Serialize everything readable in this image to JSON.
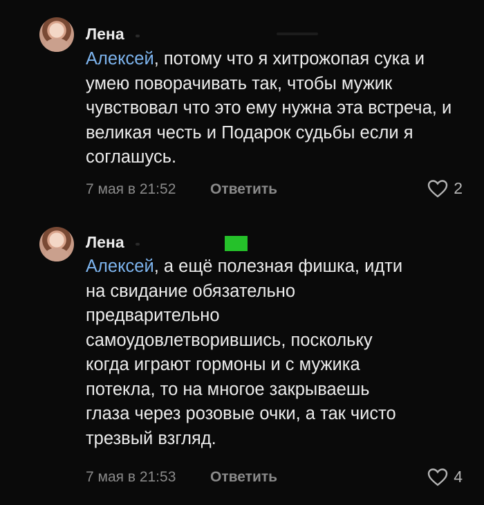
{
  "comments": [
    {
      "author": "Лена",
      "reply_to": "Алексей",
      "text": ", потому что я хитрожопая сука и умею поворачивать так, чтобы мужик чувствовал что это ему нужна эта встреча, и великая честь и Подарок судьбы если я соглашусь.",
      "date": "7 мая в 21:52",
      "reply_label": "Ответить",
      "likes": "2"
    },
    {
      "author": "Лена",
      "reply_to": "Алексей",
      "text": ", а ещё полезная фишка, идти на свидание обязательно предварительно самоудовлетворившись, поскольку когда играют гормоны и с мужика потекла, то на многое закрываешь глаза через розовые очки, а так чисто трезвый взгляд.",
      "date": "7 мая в 21:53",
      "reply_label": "Ответить",
      "likes": "4"
    }
  ],
  "icons": {
    "like": "heart-icon",
    "avatar": "avatar"
  },
  "colors": {
    "background": "#0a0a0a",
    "link": "#7db4ee",
    "meta": "#8a8a8a",
    "mark": "#25c12a"
  }
}
